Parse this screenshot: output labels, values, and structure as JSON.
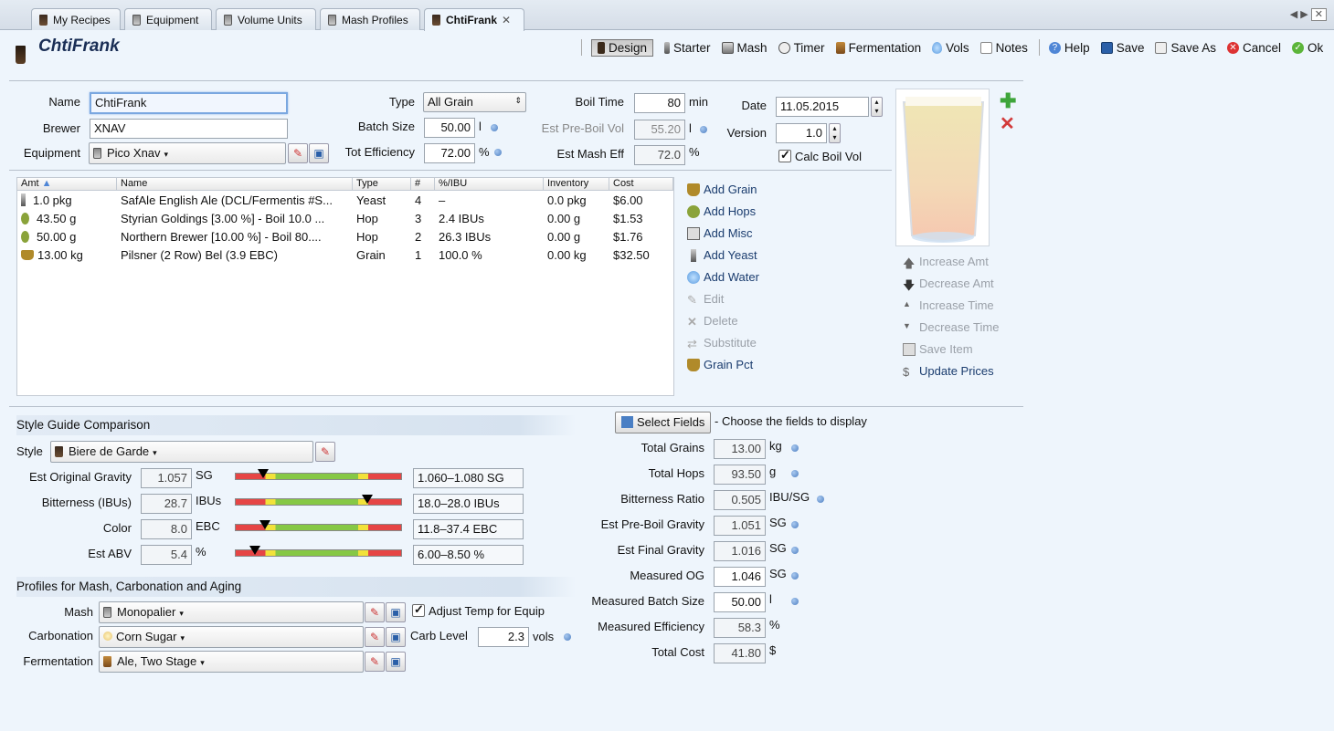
{
  "tabs": [
    {
      "label": "My Recipes"
    },
    {
      "label": "Equipment"
    },
    {
      "label": "Volume Units"
    },
    {
      "label": "Mash Profiles"
    },
    {
      "label": "ChtiFrank"
    }
  ],
  "recipe_title": "ChtiFrank",
  "toolbar": {
    "design": "Design",
    "starter": "Starter",
    "mash": "Mash",
    "timer": "Timer",
    "fermentation": "Fermentation",
    "vols": "Vols",
    "notes": "Notes",
    "help": "Help",
    "save": "Save",
    "save_as": "Save As",
    "cancel": "Cancel",
    "ok": "Ok"
  },
  "form": {
    "name_label": "Name",
    "name": "ChtiFrank",
    "brewer_label": "Brewer",
    "brewer": "XNAV",
    "equipment_label": "Equipment",
    "equipment": "Pico Xnav",
    "type_label": "Type",
    "type": "All Grain",
    "batch_size_label": "Batch Size",
    "batch_size": "50.00",
    "batch_unit": "l",
    "tot_eff_label": "Tot Efficiency",
    "tot_eff": "72.00",
    "tot_eff_unit": "%",
    "boil_time_label": "Boil Time",
    "boil_time": "80",
    "boil_unit": "min",
    "pre_boil_label": "Est Pre-Boil Vol",
    "pre_boil": "55.20",
    "pre_boil_unit": "l",
    "mash_eff_label": "Est Mash Eff",
    "mash_eff": "72.0",
    "mash_eff_unit": "%",
    "date_label": "Date",
    "date": "11.05.2015",
    "version_label": "Version",
    "version": "1.0",
    "calc_boil": "Calc Boil Vol"
  },
  "ingredients": {
    "headers": [
      "Amt",
      "Name",
      "Type",
      "#",
      "%/IBU",
      "Inventory",
      "Cost"
    ],
    "rows": [
      {
        "amt": "1.0 pkg",
        "name": "SafAle English Ale (DCL/Fermentis #S...",
        "type": "Yeast",
        "num": "4",
        "pct": "–",
        "inv": "0.0 pkg",
        "cost": "$6.00"
      },
      {
        "amt": "43.50 g",
        "name": "Styrian Goldings [3.00 %] - Boil 10.0 ...",
        "type": "Hop",
        "num": "3",
        "pct": "2.4 IBUs",
        "inv": "0.00 g",
        "cost": "$1.53"
      },
      {
        "amt": "50.00 g",
        "name": "Northern Brewer [10.00 %] - Boil 80....",
        "type": "Hop",
        "num": "2",
        "pct": "26.3 IBUs",
        "inv": "0.00 g",
        "cost": "$1.76"
      },
      {
        "amt": "13.00 kg",
        "name": "Pilsner (2 Row) Bel (3.9 EBC)",
        "type": "Grain",
        "num": "1",
        "pct": "100.0 %",
        "inv": "0.00 kg",
        "cost": "$32.50"
      }
    ]
  },
  "actions": {
    "add_grain": "Add Grain",
    "add_hops": "Add Hops",
    "add_misc": "Add Misc",
    "add_yeast": "Add Yeast",
    "add_water": "Add Water",
    "edit": "Edit",
    "delete": "Delete",
    "substitute": "Substitute",
    "grain_pct": "Grain Pct"
  },
  "side_actions": {
    "increase_amt": "Increase Amt",
    "decrease_amt": "Decrease Amt",
    "increase_time": "Increase Time",
    "decrease_time": "Decrease Time",
    "save_item": "Save Item",
    "update_prices": "Update Prices"
  },
  "style": {
    "section_title": "Style Guide Comparison",
    "style_label": "Style",
    "style": "Biere de Garde",
    "rows": [
      {
        "label": "Est Original Gravity",
        "value": "1.057",
        "unit": "SG",
        "range": "1.060–1.080 SG",
        "pointer": 0.17
      },
      {
        "label": "Bitterness (IBUs)",
        "value": "28.7",
        "unit": "IBUs",
        "range": "18.0–28.0 IBUs",
        "pointer": 0.79
      },
      {
        "label": "Color",
        "value": "8.0",
        "unit": "EBC",
        "range": "11.8–37.4 EBC",
        "pointer": 0.18
      },
      {
        "label": "Est ABV",
        "value": "5.4",
        "unit": "%",
        "range": "6.00–8.50 %",
        "pointer": 0.12
      }
    ]
  },
  "profiles": {
    "section_title": "Profiles for Mash, Carbonation and Aging",
    "mash_label": "Mash",
    "mash": "Monopalier",
    "adjust_temp": "Adjust Temp for Equip",
    "carb_label": "Carbonation",
    "carb": "Corn Sugar",
    "carb_level_label": "Carb Level",
    "carb_level": "2.3",
    "carb_unit": "vols",
    "ferm_label": "Fermentation",
    "ferm": "Ale, Two Stage"
  },
  "fields": {
    "select_label": "Select Fields",
    "select_hint": "- Choose the fields to display",
    "items": [
      {
        "label": "Total Grains",
        "value": "13.00",
        "unit": "kg"
      },
      {
        "label": "Total Hops",
        "value": "93.50",
        "unit": "g"
      },
      {
        "label": "Bitterness Ratio",
        "value": "0.505",
        "unit": "IBU/SG"
      },
      {
        "label": "Est Pre-Boil Gravity",
        "value": "1.051",
        "unit": "SG"
      },
      {
        "label": "Est Final Gravity",
        "value": "1.016",
        "unit": "SG"
      },
      {
        "label": "Measured OG",
        "value": "1.046",
        "unit": "SG"
      },
      {
        "label": "Measured Batch Size",
        "value": "50.00",
        "unit": "l"
      },
      {
        "label": "Measured Efficiency",
        "value": "58.3",
        "unit": "%"
      },
      {
        "label": "Total Cost",
        "value": "41.80",
        "unit": "$"
      }
    ]
  }
}
